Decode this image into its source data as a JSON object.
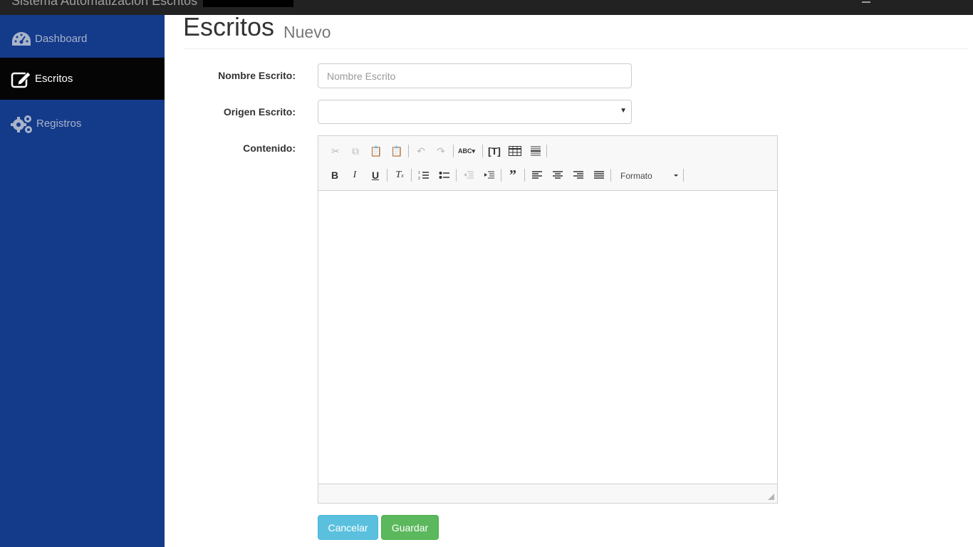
{
  "topbar": {
    "brand": "Sistema Automatización Escritos"
  },
  "sidebar": {
    "items": [
      {
        "label": "Dashboard",
        "icon": "dashboard-icon"
      },
      {
        "label": "Escritos",
        "icon": "edit-icon",
        "active": true
      },
      {
        "label": "Registros",
        "icon": "gears-icon"
      }
    ]
  },
  "header": {
    "title": "Escritos",
    "subtitle": "Nuevo"
  },
  "form": {
    "nombre_label": "Nombre Escrito:",
    "nombre_placeholder": "Nombre Escrito",
    "nombre_value": "",
    "origen_label": "Origen Escrito:",
    "origen_value": "",
    "contenido_label": "Contenido:"
  },
  "editor": {
    "toolbar_row1": [
      "cut-icon",
      "copy-icon",
      "paste-icon",
      "paste-text-icon",
      "undo-icon",
      "redo-icon",
      "spellcheck-icon",
      "text-field-icon",
      "table-icon",
      "horizontal-line-icon"
    ],
    "toolbar_row2": [
      "bold-icon",
      "italic-icon",
      "underline-icon",
      "remove-format-icon",
      "numbered-list-icon",
      "bulleted-list-icon",
      "outdent-icon",
      "indent-icon",
      "blockquote-icon",
      "align-left-icon",
      "align-center-icon",
      "align-right-icon",
      "justify-icon"
    ],
    "format_label": "Formato"
  },
  "buttons": {
    "cancel": "Cancelar",
    "save": "Guardar"
  },
  "colors": {
    "sidebar": "#143a8a",
    "active_item": "#050505",
    "topbar": "#222222",
    "info": "#5bc0de",
    "success": "#5cb85c"
  }
}
